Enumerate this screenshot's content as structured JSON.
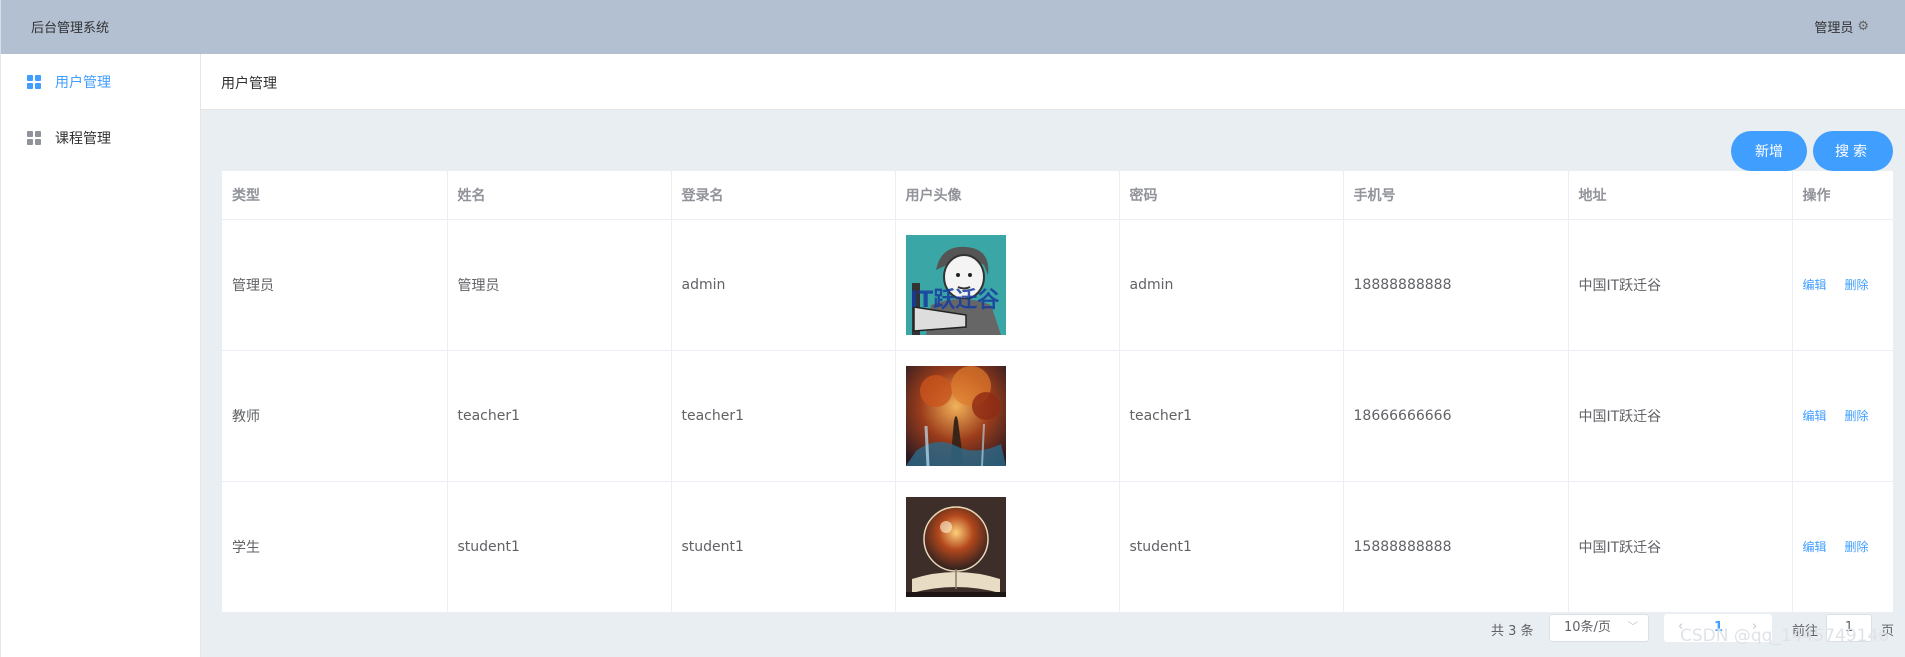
{
  "header": {
    "title": "后台管理系统",
    "user": "管理员",
    "user_icon": "gear-icon"
  },
  "sidebar": {
    "items": [
      {
        "label": "用户管理",
        "icon": "grid-icon",
        "active": true
      },
      {
        "label": "课程管理",
        "icon": "grid-icon",
        "active": false
      }
    ]
  },
  "breadcrumb": {
    "current": "用户管理"
  },
  "toolbar": {
    "add_label": "新增",
    "search_label": "搜索"
  },
  "table": {
    "columns": [
      "类型",
      "姓名",
      "登录名",
      "用户头像",
      "密码",
      "手机号",
      "地址",
      "操作"
    ],
    "rows": [
      {
        "type": "管理员",
        "name": "管理员",
        "login": "admin",
        "avatar": "cartoon-avatar",
        "password": "admin",
        "phone": "18888888888",
        "address": "中国IT跃迁谷",
        "edit": "编辑",
        "delete": "删除"
      },
      {
        "type": "教师",
        "name": "teacher1",
        "login": "teacher1",
        "avatar": "tree-painting",
        "password": "teacher1",
        "phone": "18666666666",
        "address": "中国IT跃迁谷",
        "edit": "编辑",
        "delete": "删除"
      },
      {
        "type": "学生",
        "name": "student1",
        "login": "student1",
        "avatar": "crystal-ball-book",
        "password": "student1",
        "phone": "15888888888",
        "address": "中国IT跃迁谷",
        "edit": "编辑",
        "delete": "删除"
      }
    ]
  },
  "pagination": {
    "total_text": "共 3 条",
    "page_size": "10条/页",
    "current_page": "1",
    "goto_label": "前往",
    "goto_value": "1",
    "page_suffix": "页"
  },
  "watermark": "CSDN @qq_1445749146",
  "colors": {
    "accent": "#409eff",
    "header_bg": "#b3c0d1",
    "main_bg": "#e9eef3"
  }
}
